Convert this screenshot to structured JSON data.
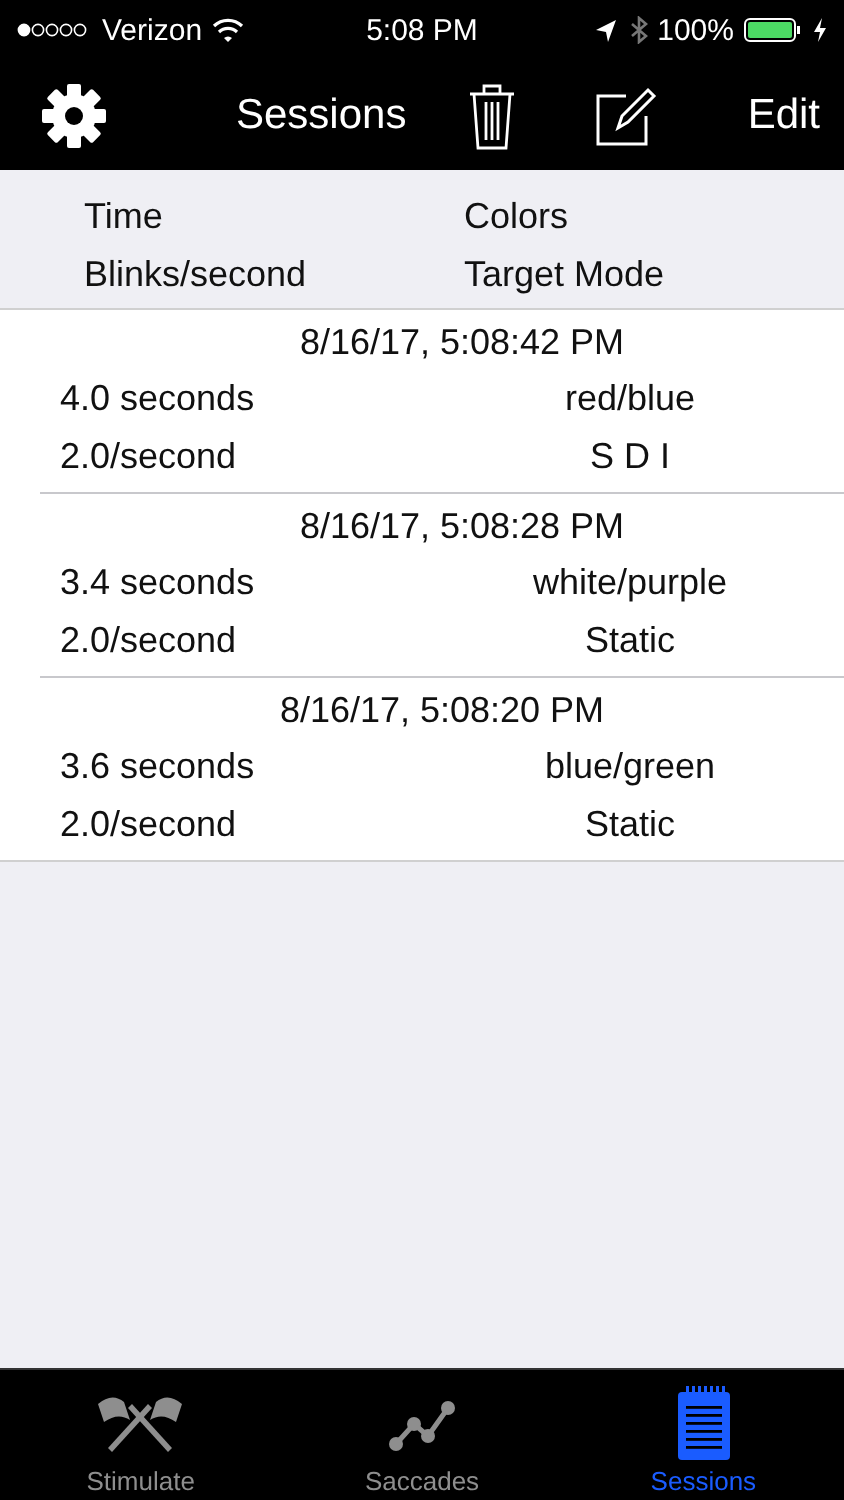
{
  "status_bar": {
    "carrier": "Verizon",
    "time": "5:08 PM",
    "battery": "100%"
  },
  "nav": {
    "title": "Sessions",
    "edit": "Edit"
  },
  "header": {
    "rows": [
      [
        "Time",
        "Colors"
      ],
      [
        "Blinks/second",
        "Target Mode"
      ]
    ]
  },
  "sessions": [
    {
      "date": "8/16/17, 5:08:42 PM",
      "duration": "4.0 seconds",
      "colors": "red/blue",
      "rate": "2.0/second",
      "mode": "S D I"
    },
    {
      "date": "8/16/17, 5:08:28 PM",
      "duration": "3.4 seconds",
      "colors": "white/purple",
      "rate": "2.0/second",
      "mode": "Static"
    },
    {
      "date": "8/16/17, 5:08:20 PM",
      "duration": "3.6 seconds",
      "colors": "blue/green",
      "rate": "2.0/second",
      "mode": "Static"
    }
  ],
  "tabs": [
    {
      "label": "Stimulate",
      "kind": "flags",
      "selected": false
    },
    {
      "label": "Saccades",
      "kind": "graph",
      "selected": false
    },
    {
      "label": "Sessions",
      "kind": "notepad",
      "selected": true
    }
  ]
}
